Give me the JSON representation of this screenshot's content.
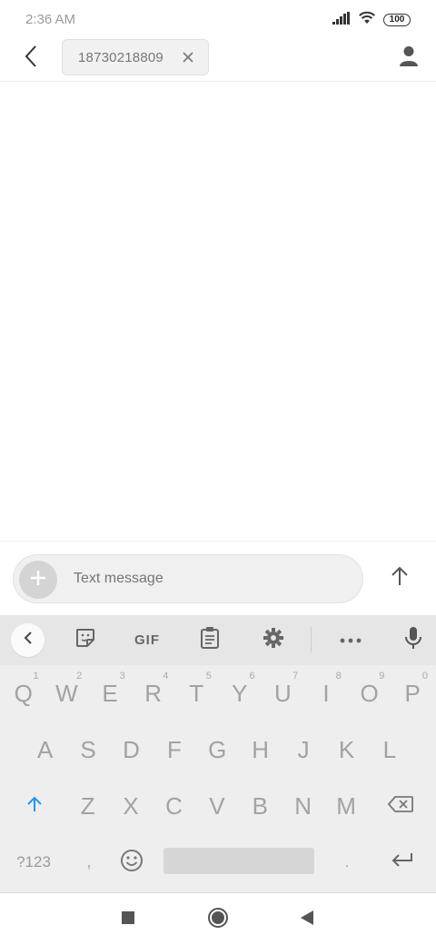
{
  "status_bar": {
    "time": "2:36 AM",
    "battery": "100",
    "icons": [
      "signal-icon",
      "wifi-icon",
      "battery-icon"
    ]
  },
  "header": {
    "back_icon": "back-arrow-icon",
    "recipient": "18730218809",
    "remove_icon": "close-icon",
    "contact_icon": "person-icon"
  },
  "compose": {
    "placeholder": "Text message",
    "attach_icon": "plus-icon",
    "send_icon": "arrow-up-icon"
  },
  "keyboard": {
    "toolbar": {
      "collapse_icon": "chevron-left-icon",
      "sticker_icon": "sticker-icon",
      "gif_label": "GIF",
      "clipboard_icon": "clipboard-icon",
      "settings_icon": "gear-icon",
      "more_icon": "more-horizontal-icon",
      "mic_icon": "microphone-icon"
    },
    "row1": [
      {
        "char": "Q",
        "hint": "1"
      },
      {
        "char": "W",
        "hint": "2"
      },
      {
        "char": "E",
        "hint": "3"
      },
      {
        "char": "R",
        "hint": "4"
      },
      {
        "char": "T",
        "hint": "5"
      },
      {
        "char": "Y",
        "hint": "6"
      },
      {
        "char": "U",
        "hint": "7"
      },
      {
        "char": "I",
        "hint": "8"
      },
      {
        "char": "O",
        "hint": "9"
      },
      {
        "char": "P",
        "hint": "0"
      }
    ],
    "row2": [
      "A",
      "S",
      "D",
      "F",
      "G",
      "H",
      "J",
      "K",
      "L"
    ],
    "row3": [
      "Z",
      "X",
      "C",
      "V",
      "B",
      "N",
      "M"
    ],
    "shift_icon": "shift-arrow-icon",
    "backspace_icon": "backspace-icon",
    "symbols_label": "?123",
    "comma_label": ",",
    "emoji_icon": "emoji-icon",
    "period_label": ".",
    "enter_icon": "enter-icon",
    "accent_color": "#2196f3"
  },
  "nav_bar": {
    "recents_icon": "square-icon",
    "home_icon": "circle-icon",
    "back_icon": "triangle-back-icon"
  }
}
